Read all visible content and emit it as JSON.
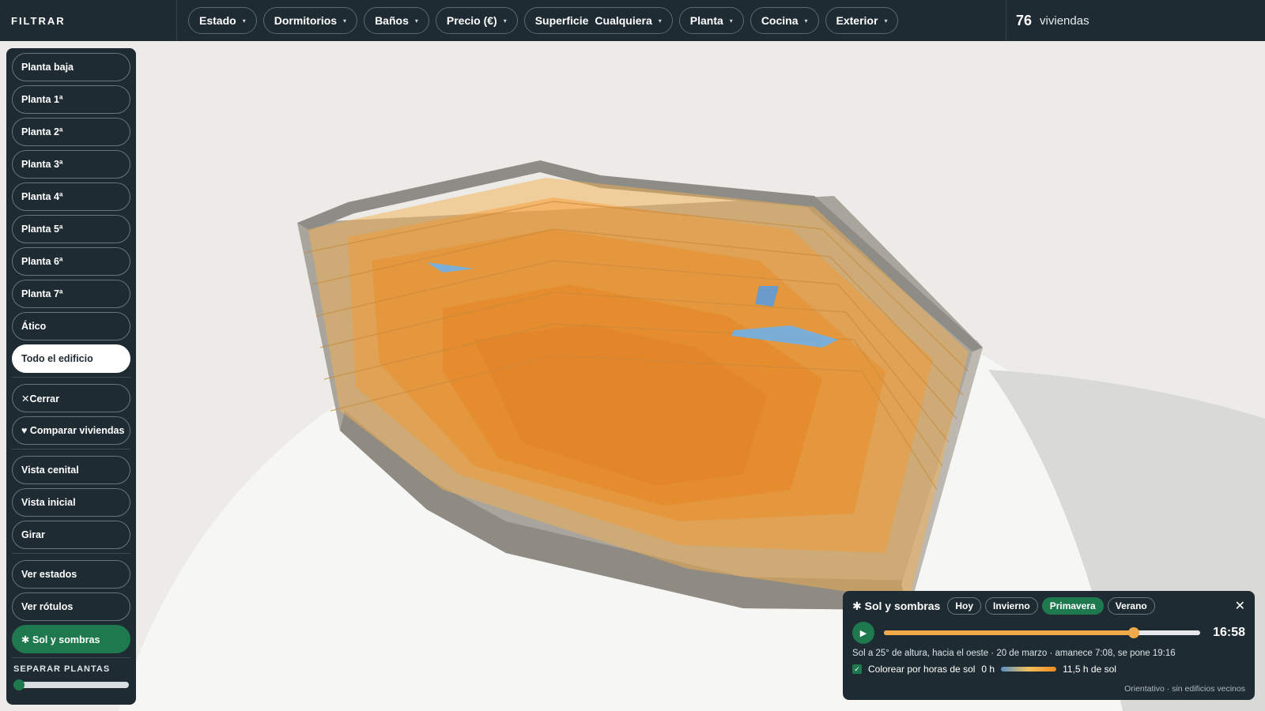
{
  "topbar": {
    "brand": "FILTRAR",
    "filters": [
      {
        "label": "Estado",
        "value": ""
      },
      {
        "label": "Dormitorios",
        "value": ""
      },
      {
        "label": "Baños",
        "value": ""
      },
      {
        "label": "Precio (€)",
        "value": ""
      },
      {
        "label": "Superficie",
        "value": "Cualquiera"
      },
      {
        "label": "Planta",
        "value": ""
      },
      {
        "label": "Cocina",
        "value": ""
      },
      {
        "label": "Exterior",
        "value": ""
      }
    ],
    "caret": "▾",
    "count": "76",
    "count_label": "viviendas"
  },
  "sidebar": {
    "floors": [
      "Planta baja",
      "Planta 1ª",
      "Planta 2ª",
      "Planta 3ª",
      "Planta 4ª",
      "Planta 5ª",
      "Planta 6ª",
      "Planta 7ª",
      "Ático",
      "Todo el edificio"
    ],
    "active_floor": "Todo el edificio",
    "close_label": "✕Cerrar",
    "compare_label": "♥ Comparar viviendas",
    "views": [
      "Vista cenital",
      "Vista inicial",
      "Girar"
    ],
    "toggles": [
      "Ver estados",
      "Ver rótulos"
    ],
    "sun_label": "✱ Sol y sombras",
    "separate_title": "SEPARAR PLANTAS",
    "separate_value": 0
  },
  "sun_panel": {
    "title": "✱ Sol y sombras",
    "seasons": [
      "Hoy",
      "Invierno",
      "Primavera",
      "Verano"
    ],
    "active_season": "Primavera",
    "close": "✕",
    "play": "▶",
    "time": "16:58",
    "time_progress": 0.79,
    "description": "Sol a 25° de altura, hacia el oeste · 20 de marzo · amanece 7:08, se pone 19:16",
    "checkbox_label": "Colorear por horas de sol",
    "checkbox_checked": true,
    "legend_min": "0 h",
    "legend_max": "11,5 h de sol",
    "note": "Orientativo · sin edificios vecinos"
  },
  "colors": {
    "panel": "#1f2b33",
    "accent_green": "#1e7a4e",
    "sun_orange": "#f0a94a",
    "unit_orange": "#f08a2a",
    "ground": "#f5f5f3"
  }
}
